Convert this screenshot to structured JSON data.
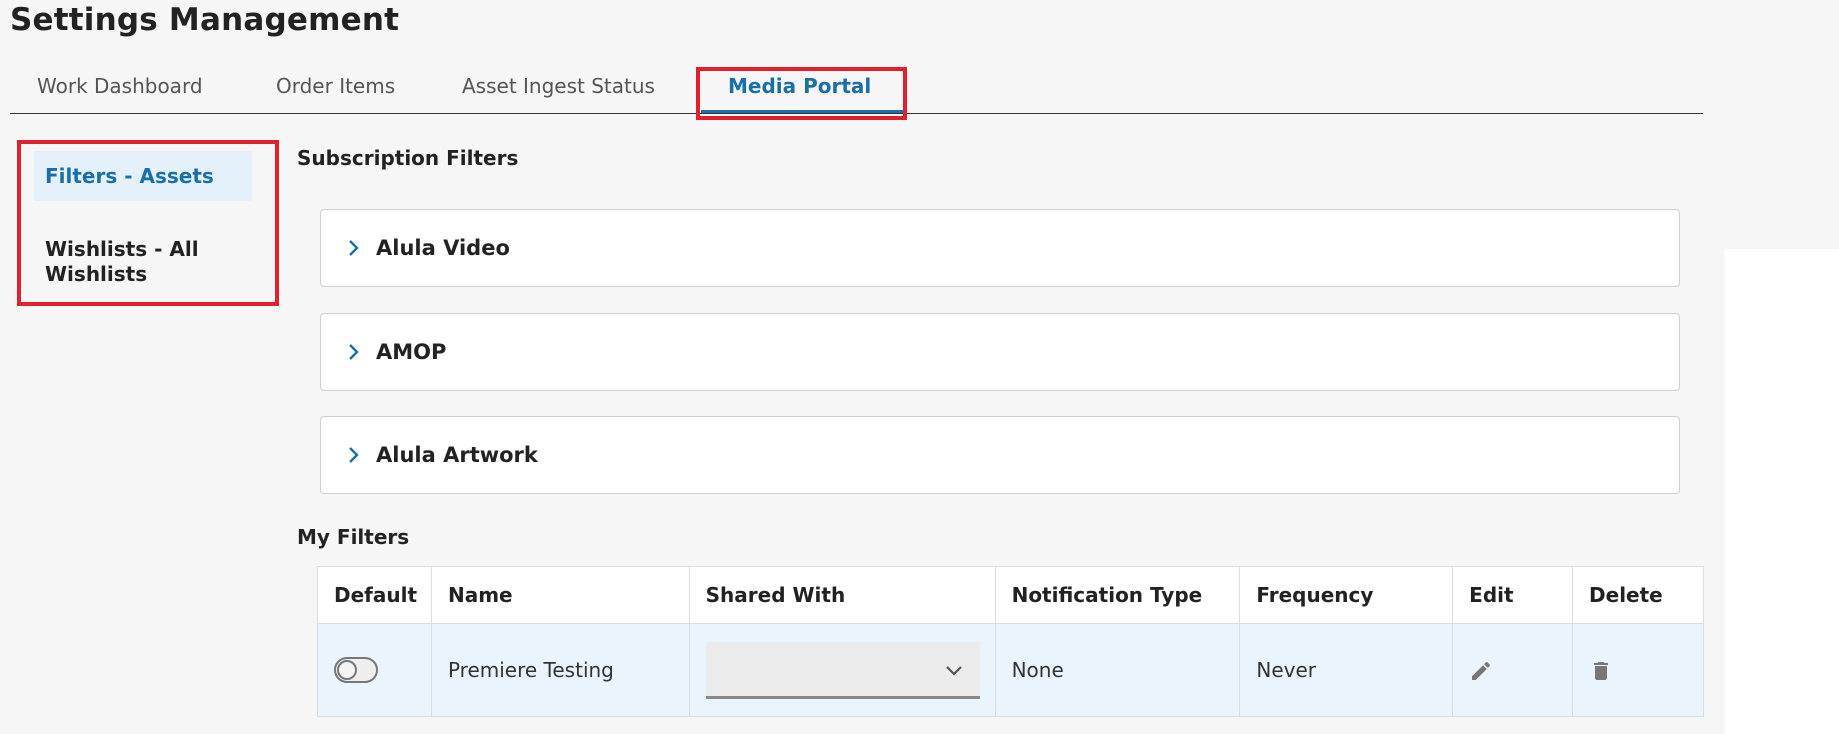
{
  "page": {
    "title": "Settings Management"
  },
  "tabs": [
    {
      "label": "Work Dashboard"
    },
    {
      "label": "Order Items"
    },
    {
      "label": "Asset Ingest Status"
    },
    {
      "label": "Media Portal",
      "active": true
    }
  ],
  "sidebar": {
    "items": [
      {
        "label": "Filters - Assets",
        "active": true
      },
      {
        "label": "Wishlists - All Wishlists"
      }
    ]
  },
  "subscription_filters": {
    "title": "Subscription Filters",
    "items": [
      {
        "label": "Alula Video"
      },
      {
        "label": "AMOP"
      },
      {
        "label": "Alula Artwork"
      }
    ]
  },
  "my_filters": {
    "title": "My Filters",
    "columns": [
      "Default",
      "Name",
      "Shared With",
      "Notification Type",
      "Frequency",
      "Edit",
      "Delete"
    ],
    "rows": [
      {
        "default_on": false,
        "name": "Premiere Testing",
        "shared_with": "",
        "notification_type": "None",
        "frequency": "Never"
      }
    ]
  },
  "icons": {
    "accordion": "chevron-right-icon",
    "select": "chevron-down-icon",
    "edit": "pencil-icon",
    "delete": "trash-icon"
  },
  "colors": {
    "accent": "#1b6fa8",
    "highlight_box": "#e0202a",
    "active_bg": "#e4f1fb",
    "row_bg": "#e9f4fc",
    "page_bg": "#f6f6f6"
  }
}
